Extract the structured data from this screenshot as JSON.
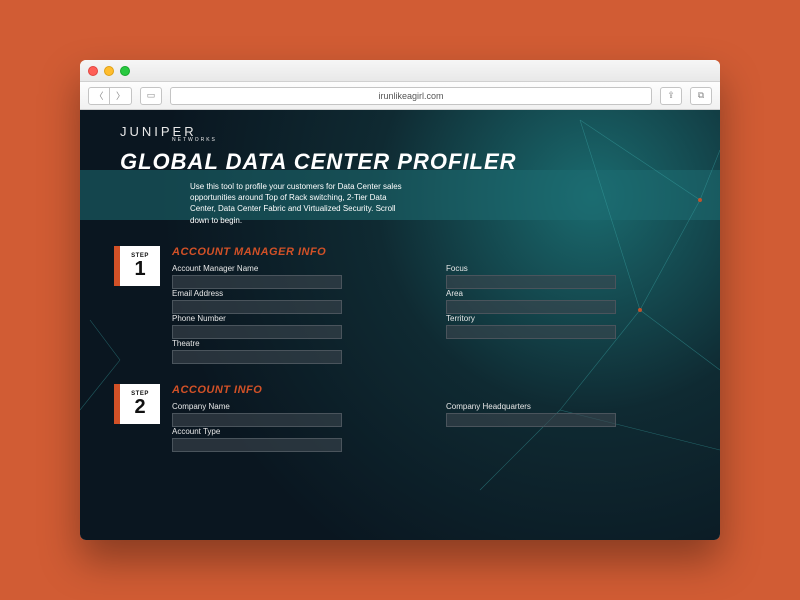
{
  "browser": {
    "url": "irunlikeagirl.com"
  },
  "brand": {
    "name": "JUNIPER",
    "sub": "NETWORKS"
  },
  "page_title": "GLOBAL DATA CENTER PROFILER",
  "intro": "Use this tool to profile your customers for Data Center sales opportunities around Top of Rack switching, 2-Tier Data Center, Data Center Fabric and Virtualized Security. Scroll down to begin.",
  "step_label": "STEP",
  "sections": [
    {
      "num": "1",
      "title": "ACCOUNT MANAGER INFO",
      "fields_left": [
        "Account Manager Name",
        "Email Address",
        "Phone Number",
        "Theatre"
      ],
      "fields_right": [
        "Focus",
        "Area",
        "Territory"
      ]
    },
    {
      "num": "2",
      "title": "ACCOUNT INFO",
      "fields_left": [
        "Company Name",
        "Account Type"
      ],
      "fields_right": [
        "Company Headquarters"
      ]
    }
  ]
}
